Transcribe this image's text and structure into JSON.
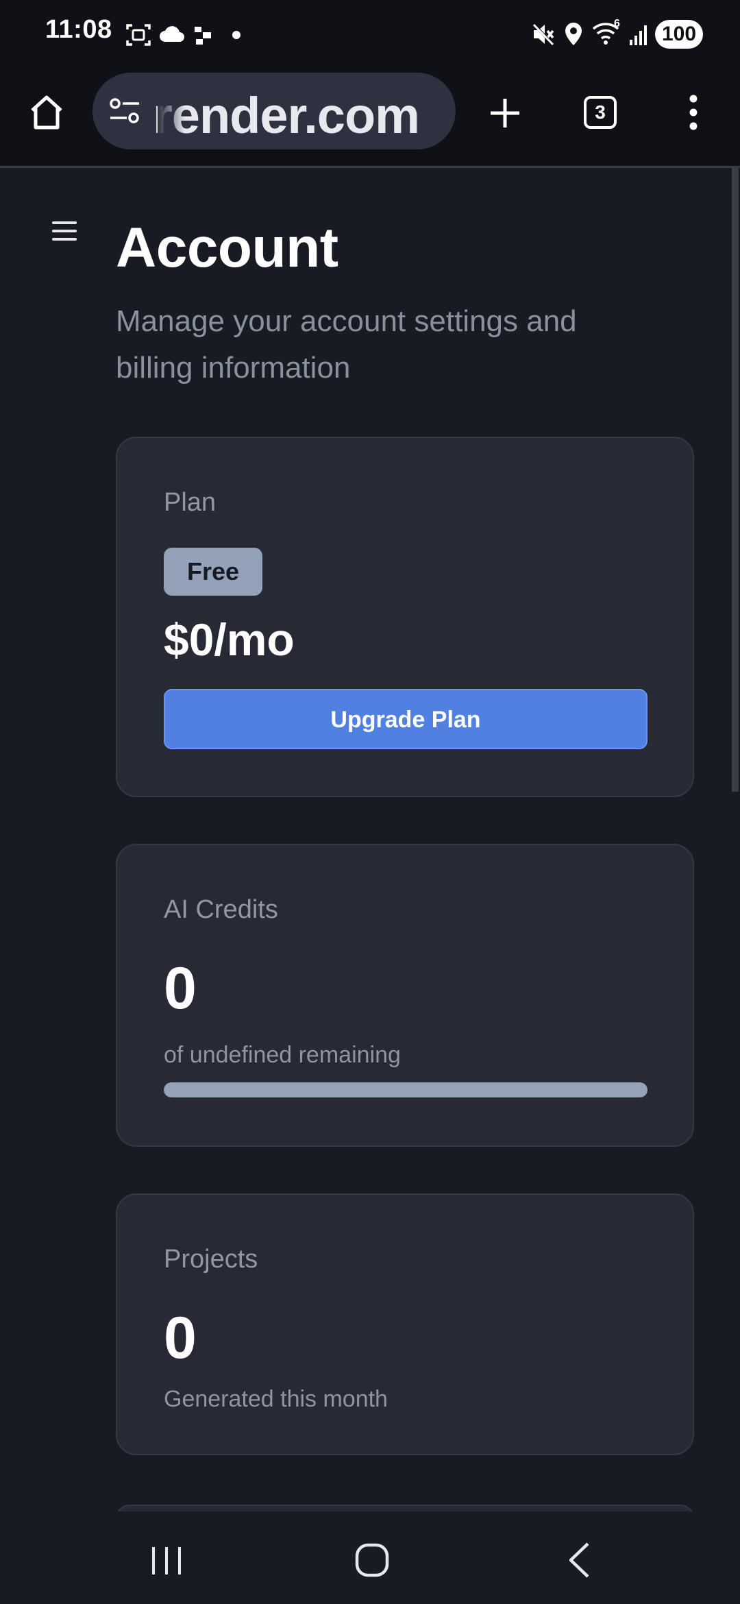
{
  "status_bar": {
    "time": "11:08",
    "battery": "100",
    "left_icons": [
      "screenshot-icon",
      "cloud-icon",
      "app-icon",
      "dot-icon"
    ],
    "right_icons": [
      "mute-icon",
      "location-icon",
      "wifi-icon",
      "signal-icon",
      "battery-icon"
    ],
    "wifi_label": "6"
  },
  "browser": {
    "url": "render.com",
    "tab_count": "3",
    "icons": [
      "home-icon",
      "site-settings-icon",
      "new-tab-icon",
      "tabs-icon",
      "more-vert-icon"
    ]
  },
  "page": {
    "title": "Account",
    "subtitle": "Manage your account settings and billing information"
  },
  "plan_card": {
    "label": "Plan",
    "badge": "Free",
    "price": "$0/mo",
    "upgrade_label": "Upgrade Plan"
  },
  "credits_card": {
    "label": "AI Credits",
    "value": "0",
    "caption": "of undefined remaining",
    "progress_fraction": 1.0
  },
  "projects_card": {
    "label": "Projects",
    "value": "0",
    "caption": "Generated this month"
  },
  "colors": {
    "background": "#181b23",
    "card": "#272a34",
    "accent_blue": "#5080e2",
    "badge": "#93a2b8",
    "progress_fill": "#95a3b7"
  },
  "nav_bar": {
    "icons": [
      "recents-icon",
      "home-nav-icon",
      "back-icon"
    ]
  }
}
